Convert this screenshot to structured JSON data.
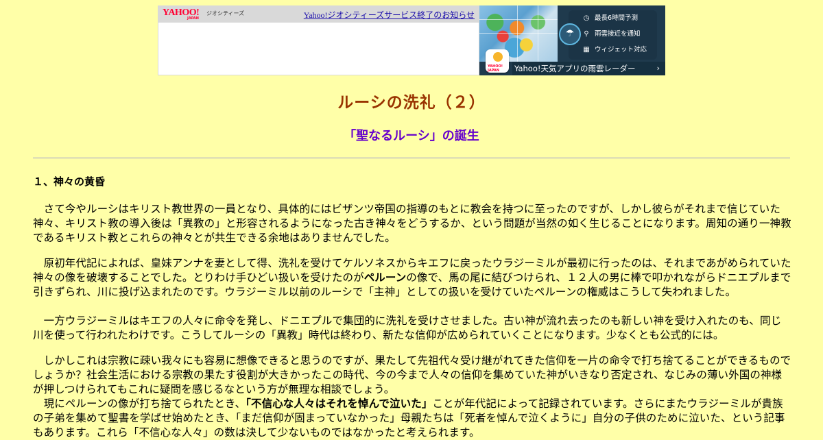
{
  "banner": {
    "logo_main": "YAHOO!",
    "logo_sub": "JAPAN",
    "service_name": "ジオシティーズ",
    "notice_link": "Yahoo!ジオシティーズサービス終了のお知らせ",
    "weather_app_icon_label": "YAHOO! JAPAN",
    "features": [
      {
        "icon": "clock-icon",
        "glyph": "◷",
        "label": "最長6時間予測"
      },
      {
        "icon": "location-pin-icon",
        "glyph": "⚲",
        "label": "雨雲接近を通知"
      },
      {
        "icon": "widget-grid-icon",
        "glyph": "▦",
        "label": "ウィジェット対応"
      }
    ],
    "rain_icon": "☂",
    "radar_link": "Yahoo!天気アプリの雨雲レーダー",
    "radar_chevron": "›"
  },
  "page": {
    "title": "ルーシの洗礼（２）",
    "subtitle": "「聖なるルーシ」の誕生",
    "section_heading": "１、神々の黄昏"
  },
  "paragraphs": {
    "p1": "　さて今やルーシはキリスト教世界の一員となり、具体的にはビザンツ帝国の指導のもとに教会を持つに至ったのですが、しかし彼らがそれまで信じていた神々、キリスト教の導入後は「異教の」と形容されるようになった古き神々をどうするか、という問題が当然の如く生じることになります。周知の通り一神教であるキリスト教とこれらの神々とが共生できる余地はありませんでした。",
    "p2_a": "　原初年代記によれば、皇妹アンナを妻として得、洗礼を受けてケルソネスからキエフに戻ったウラジーミルが最初に行ったのは、それまであがめられていた神々の像を破壊することでした。とりわけ手ひどい扱いを受けたのが",
    "p2_bold": "ペルーン",
    "p2_b": "の像で、馬の尾に結びつけられ、１２人の男に棒で叩かれながらドニエプルまで引きずられ、川に投げ込まれたのです。ウラジーミル以前のルーシで「主神」としての扱いを受けていたペルーンの権威はこうして失われました。",
    "p3": "　一方ウラジーミルはキエフの人々に命令を発し、ドニエプルで集団的に洗礼を受けさせました。古い神が流れ去ったのも新しい神を受け入れたのも、同じ川を使って行われたわけです。こうしてルーシの「異教」時代は終わり、新たな信仰が広められていくことになります。少なくとも公式的には。",
    "p4": "　しかしこれは宗教に疎い我々にも容易に想像できると思うのですが、果たして先祖代々受け継がれてきた信仰を一片の命令で打ち捨てることができるものでしょうか？社会生活における宗教の果たす役割が大きかったこの時代、今の今まで人々の信仰を集めていた神がいきなり否定され、なじみの薄い外国の神様が押しつけられてもこれに疑問を感じるなという方が無理な相談でしょう。",
    "p5_a": "　現にペルーンの像が打ち捨てられたとき、",
    "p5_bold": "「不信心な人々はそれを悼んで泣いた」",
    "p5_b": "ことが年代記によって記録されています。さらにまたウラジーミルが貴族の子弟を集めて聖書を学ばせ始めたとき、「まだ信仰が固まっていなかった」母親たちは「死者を悼んで泣くように」自分の子供のために泣いた、という記事もあります。これら「不信心な人々」の数は決して少ないものではなかったと考えられます。"
  },
  "colors": {
    "background": "#ffffa8",
    "title": "#993300",
    "subtitle": "#6600cc",
    "link": "#1a0dab",
    "rule": "#9a9ad0"
  }
}
